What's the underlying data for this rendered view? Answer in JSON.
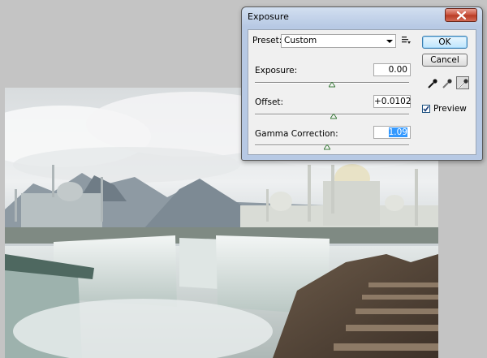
{
  "dialog": {
    "title": "Exposure",
    "close_icon": "close-x-icon",
    "preset_label": "Preset:",
    "preset_value": "Custom",
    "preset_menu_icon": "preset-options-icon",
    "exposure_label": "Exposure:",
    "exposure_value": "0.00",
    "exposure_slider_fraction": 0.5,
    "offset_label": "Offset:",
    "offset_value": "+0.0102",
    "offset_slider_fraction": 0.51,
    "gamma_label": "Gamma Correction:",
    "gamma_value": "1.09",
    "gamma_slider_fraction": 0.47,
    "ok_label": "OK",
    "cancel_label": "Cancel",
    "eyedroppers": [
      "black-point-eyedropper-icon",
      "gray-point-eyedropper-icon",
      "white-point-eyedropper-icon"
    ],
    "preview_label": "Preview",
    "preview_checked": true
  },
  "colors": {
    "titlebar": "#b7c9e4",
    "close_button": "#c9503b",
    "workspace": "#c4c4c4",
    "ok_button": "#bee6fd",
    "selection": "#3399ff"
  }
}
